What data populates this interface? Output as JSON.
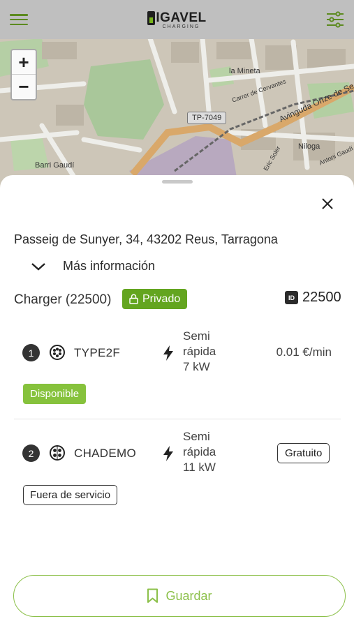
{
  "app": {
    "logo_text": "IGAVEL",
    "logo_sub": "CHARGING"
  },
  "map": {
    "zoom_in": "+",
    "zoom_out": "−",
    "labels": {
      "la_mineta": "la Mineta",
      "carrer_cervantes": "Carrer de Cervantes",
      "avinguda": "Avinguda Onze de Se",
      "niloga": "Niloga",
      "barri_gaudi": "Barri Gaudí",
      "road": "TP-7049",
      "eric_soler": "Eric Soler",
      "antoni_gaudi": "Antoni Gaudí"
    }
  },
  "sheet": {
    "address": "Passeig de Sunyer, 34, 43202 Reus, Tarragona",
    "more_info": "Más información",
    "charger_title": "Charger (22500)",
    "privado": "Privado",
    "id_badge": "ID",
    "id_value": "22500",
    "connectors": [
      {
        "index": "1",
        "type": "TYPE2F",
        "power_line1": "Semi",
        "power_line2": "rápida",
        "power_line3": "7 kW",
        "price": "0.01 €/min",
        "status": "Disponible"
      },
      {
        "index": "2",
        "type": "CHADEMO",
        "power_line1": "Semi",
        "power_line2": "rápida",
        "power_line3": "11 kW",
        "price": "Gratuito",
        "status": "Fuera de servicio"
      }
    ],
    "save_label": "Guardar"
  },
  "colors": {
    "brand_green": "#63a51f",
    "light_green": "#86c23c",
    "outline_green": "#8cc04a"
  }
}
